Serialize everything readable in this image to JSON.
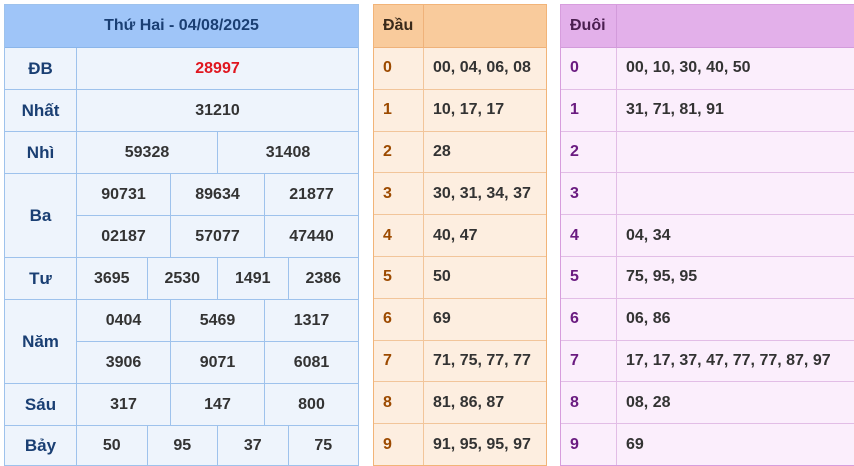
{
  "results": {
    "title": "Thứ Hai - 04/08/2025",
    "prizes": [
      {
        "label": "ĐB",
        "lines": [
          [
            "28997"
          ]
        ]
      },
      {
        "label": "Nhất",
        "lines": [
          [
            "31210"
          ]
        ]
      },
      {
        "label": "Nhì",
        "lines": [
          [
            "59328",
            "31408"
          ]
        ]
      },
      {
        "label": "Ba",
        "lines": [
          [
            "90731",
            "89634",
            "21877"
          ],
          [
            "02187",
            "57077",
            "47440"
          ]
        ]
      },
      {
        "label": "Tư",
        "lines": [
          [
            "3695",
            "2530",
            "1491",
            "2386"
          ]
        ]
      },
      {
        "label": "Năm",
        "lines": [
          [
            "0404",
            "5469",
            "1317"
          ],
          [
            "3906",
            "9071",
            "6081"
          ]
        ]
      },
      {
        "label": "Sáu",
        "lines": [
          [
            "317",
            "147",
            "800"
          ]
        ]
      },
      {
        "label": "Bảy",
        "lines": [
          [
            "50",
            "95",
            "37",
            "75"
          ]
        ]
      }
    ],
    "special_color": "#e0161f"
  },
  "dau": {
    "header": "Đầu",
    "rows": [
      {
        "digit": "0",
        "values": "00, 04, 06, 08"
      },
      {
        "digit": "1",
        "values": "10, 17, 17"
      },
      {
        "digit": "2",
        "values": "28"
      },
      {
        "digit": "3",
        "values": "30, 31, 34, 37"
      },
      {
        "digit": "4",
        "values": "40, 47"
      },
      {
        "digit": "5",
        "values": "50"
      },
      {
        "digit": "6",
        "values": "69"
      },
      {
        "digit": "7",
        "values": "71, 75, 77, 77"
      },
      {
        "digit": "8",
        "values": "81, 86, 87"
      },
      {
        "digit": "9",
        "values": "91, 95, 95, 97"
      }
    ]
  },
  "duoi": {
    "header": "Đuôi",
    "rows": [
      {
        "digit": "0",
        "values": "00, 10, 30, 40, 50"
      },
      {
        "digit": "1",
        "values": "31, 71, 81, 91"
      },
      {
        "digit": "2",
        "values": ""
      },
      {
        "digit": "3",
        "values": ""
      },
      {
        "digit": "4",
        "values": "04, 34"
      },
      {
        "digit": "5",
        "values": "75, 95, 95"
      },
      {
        "digit": "6",
        "values": "06, 86"
      },
      {
        "digit": "7",
        "values": "17, 17, 37, 47, 77, 77, 87, 97"
      },
      {
        "digit": "8",
        "values": "08, 28"
      },
      {
        "digit": "9",
        "values": "69"
      }
    ]
  }
}
